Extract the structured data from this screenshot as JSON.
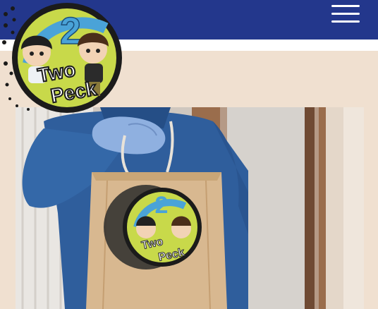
{
  "header": {
    "menu_label": "menu"
  },
  "logo": {
    "brand_word_1": "Two",
    "brand_word_2": "Peck",
    "numeral": "2"
  },
  "bag_logo": {
    "brand_word_1": "Two",
    "brand_word_2": "Peck",
    "numeral": "2"
  },
  "colors": {
    "header": "#23378c",
    "content_bg": "#f0e0d0",
    "badge_green": "#c8d94a",
    "badge_blue": "#4aa3d8",
    "glove": "#8fb0e0",
    "hoodie": "#2f5e9c",
    "bag": "#d8b890"
  }
}
